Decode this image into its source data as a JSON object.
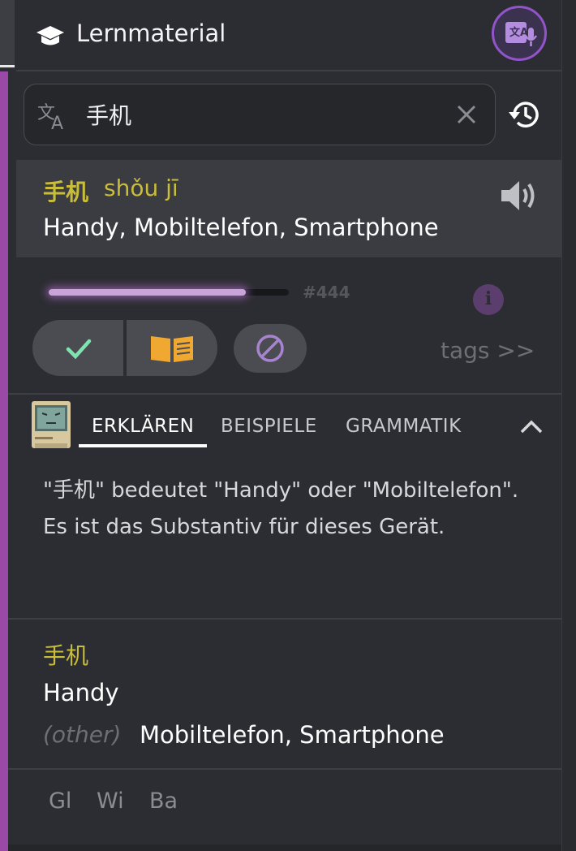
{
  "header": {
    "title": "Lernmaterial",
    "icon": "graduation-cap-icon",
    "action_icon": "translate-mic-icon",
    "accent": "#9254c9"
  },
  "search": {
    "value": "手机",
    "placeholder": "",
    "lang_icon": "translate-icon",
    "clear_icon": "close-icon",
    "history_icon": "history-icon"
  },
  "result": {
    "hanzi": "手机",
    "pinyin": "shǒu jī",
    "meaning": "Handy, Mobiltelefon, Smartphone",
    "hanzi_color": "#c9bd3c"
  },
  "progress": {
    "fraction": 0.82,
    "rank": "#444"
  },
  "actions": {
    "known_icon": "check-icon",
    "learn_icon": "open-book-icon",
    "ignore_icon": "block-icon",
    "tags_link": "tags >>"
  },
  "tabs": {
    "items": [
      "ERKLÄREN",
      "BEISPIELE",
      "GRAMMATIK"
    ],
    "active": "ERKLÄREN"
  },
  "explanation": "\"手机\" bedeutet \"Handy\" oder \"Mobiltelefon\". Es ist das Substantiv für dieses Gerät.",
  "dictionary": {
    "hanzi": "手机",
    "main": "Handy",
    "other_tag": "(other)",
    "other_values": "Mobiltelefon, Smartphone"
  },
  "sources": [
    "Gl",
    "Wi",
    "Ba"
  ]
}
